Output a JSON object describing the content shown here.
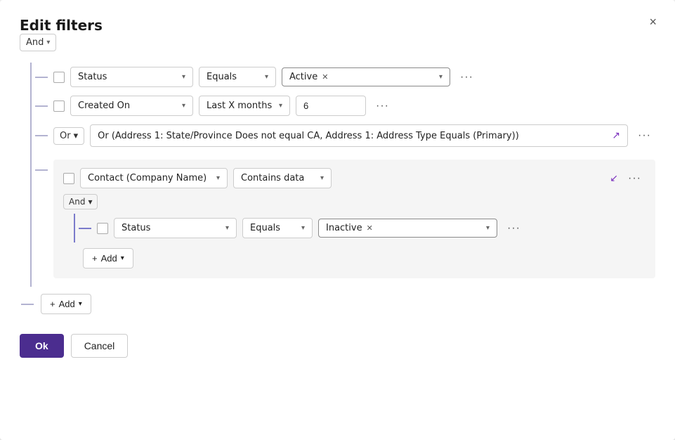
{
  "dialog": {
    "title": "Edit filters",
    "close_label": "×"
  },
  "top_and": {
    "label": "And",
    "chevron": "▾"
  },
  "rows": [
    {
      "id": "row1",
      "field": "Status",
      "condition": "Equals",
      "value_tag": "Active",
      "more": "···"
    },
    {
      "id": "row2",
      "field": "Created On",
      "condition": "Last X months",
      "value_num": "6",
      "more": "···"
    }
  ],
  "or_row": {
    "label": "Or",
    "chevron": "▾",
    "description": "Or (Address 1: State/Province Does not equal CA, Address 1: Address Type Equals (Primary))",
    "more": "···"
  },
  "nested_group": {
    "checkbox": false,
    "field": "Contact (Company Name)",
    "condition": "Contains data",
    "more": "···",
    "and_label": "And",
    "and_chevron": "▾",
    "inner_row": {
      "field": "Status",
      "condition": "Equals",
      "value_tag": "Inactive",
      "more": "···"
    },
    "add_label": "Add",
    "add_plus": "+",
    "add_chevron": "▾"
  },
  "bottom_add": {
    "label": "Add",
    "plus": "+",
    "chevron": "▾"
  },
  "footer": {
    "ok_label": "Ok",
    "cancel_label": "Cancel"
  }
}
